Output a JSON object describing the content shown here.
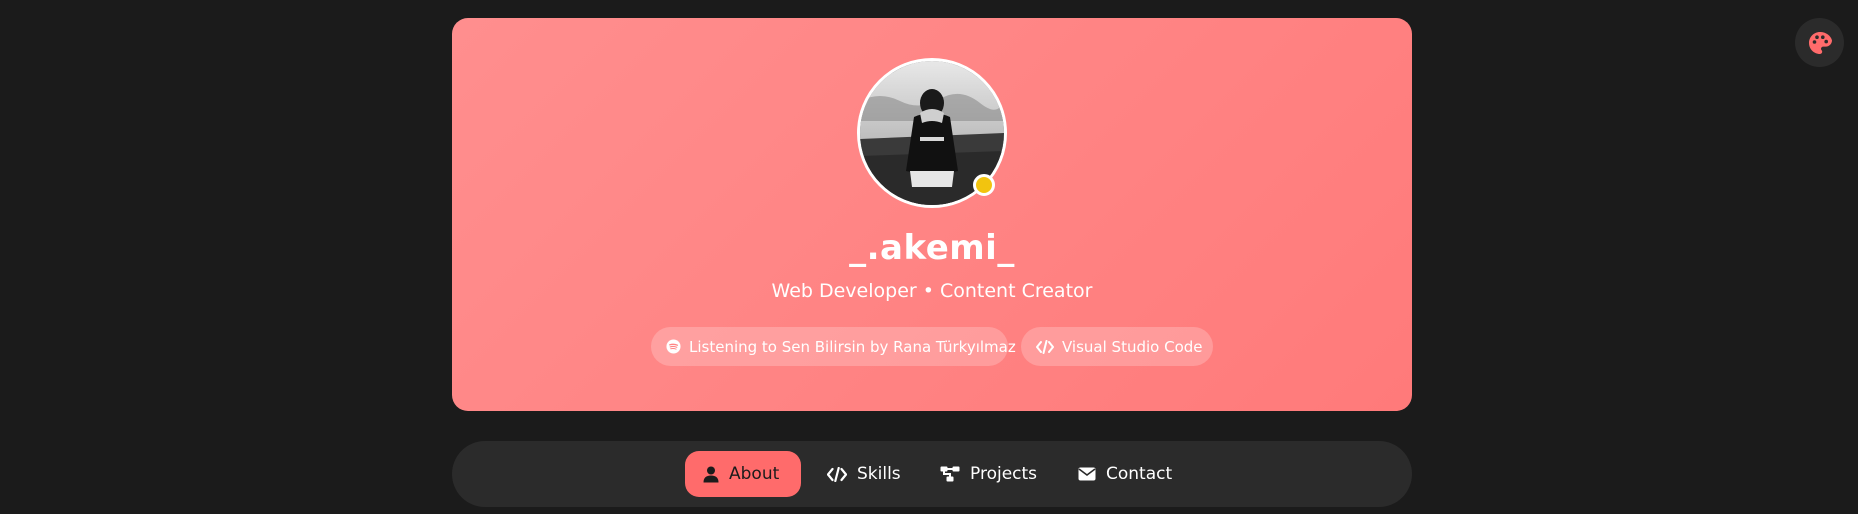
{
  "colors": {
    "page_bg": "#1b1b1b",
    "card_gradient_start": "#ff8e8e",
    "card_gradient_end": "#ff7a7a",
    "accent": "#ff6b6b",
    "status_dot": "#f2c40f",
    "nav_bg": "#2b2b2b"
  },
  "theme_toggle": {
    "icon": "palette-icon"
  },
  "profile": {
    "username": "_.akemi_",
    "tagline": "Web Developer • Content Creator",
    "status": "idle"
  },
  "activities": [
    {
      "icon": "spotify-icon",
      "label": "Listening to Sen Bilirsin by Rana Türkyılmaz"
    },
    {
      "icon": "code-icon",
      "label": "Visual Studio Code"
    }
  ],
  "nav": {
    "items": [
      {
        "icon": "user-icon",
        "label": "About",
        "active": true
      },
      {
        "icon": "code-icon",
        "label": "Skills",
        "active": false
      },
      {
        "icon": "sitemap-icon",
        "label": "Projects",
        "active": false
      },
      {
        "icon": "envelope-icon",
        "label": "Contact",
        "active": false
      }
    ]
  }
}
